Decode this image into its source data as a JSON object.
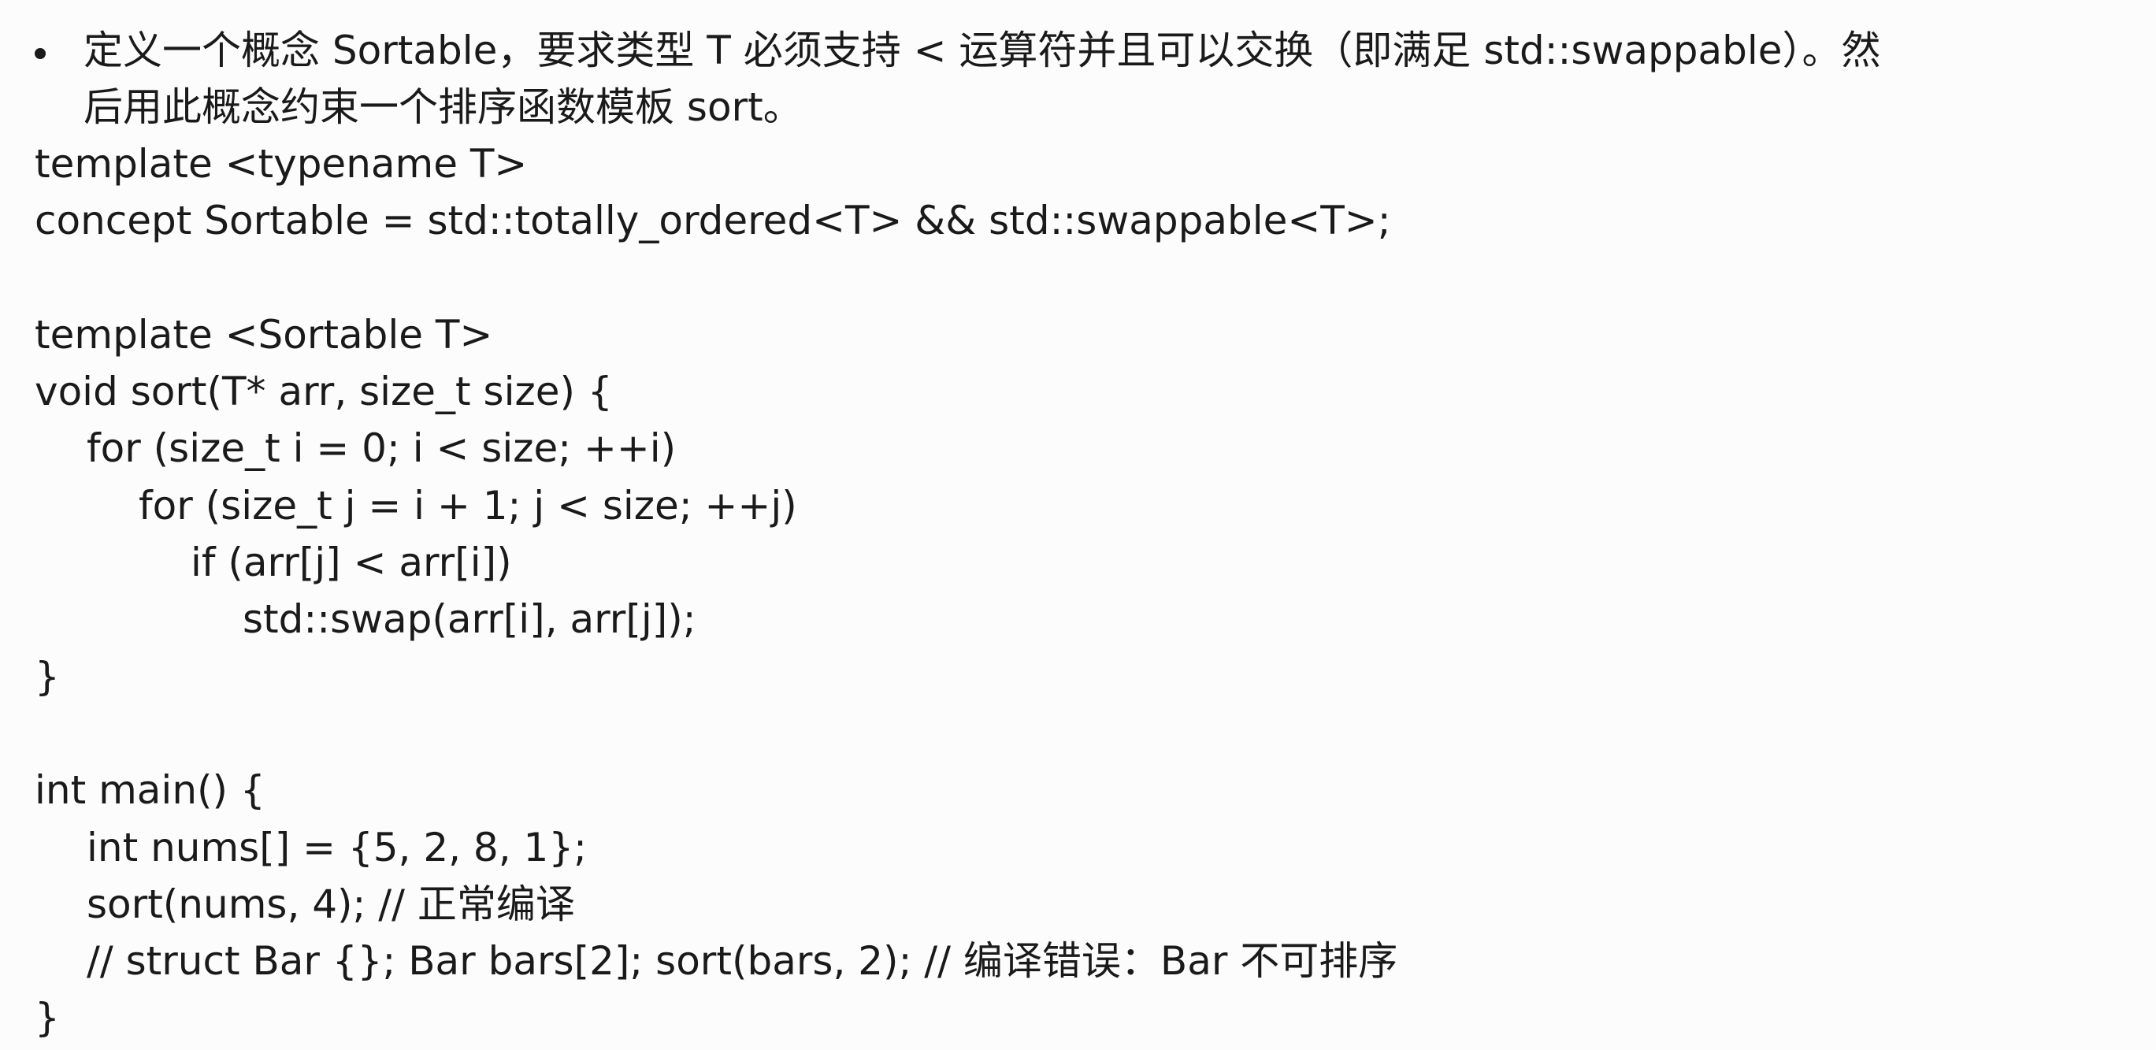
{
  "question": {
    "line1": "定义一个概念 Sortable，要求类型 T 必须支持 < 运算符并且可以交换（即满足 std::swappable）。然",
    "line2": "后用此概念约束一个排序函数模板 sort。"
  },
  "code": {
    "l01": "template <typename T>",
    "l02": "concept Sortable = std::totally_ordered<T> && std::swappable<T>;",
    "l03": "",
    "l04": "template <Sortable T>",
    "l05": "void sort(T* arr, size_t size) {",
    "l06": "for (size_t i = 0; i < size; ++i)",
    "l07": "for (size_t j = i + 1; j < size; ++j)",
    "l08": "if (arr[j] < arr[i])",
    "l09": "std::swap(arr[i], arr[j]);",
    "l10": "}",
    "l11": "",
    "l12": "int main() {",
    "l13": "int nums[] = {5, 2, 8, 1};",
    "l14": "sort(nums, 4); // 正常编译",
    "l15": "// struct Bar {}; Bar bars[2]; sort(bars, 2); // 编译错误：Bar 不可排序",
    "l16": "}"
  }
}
